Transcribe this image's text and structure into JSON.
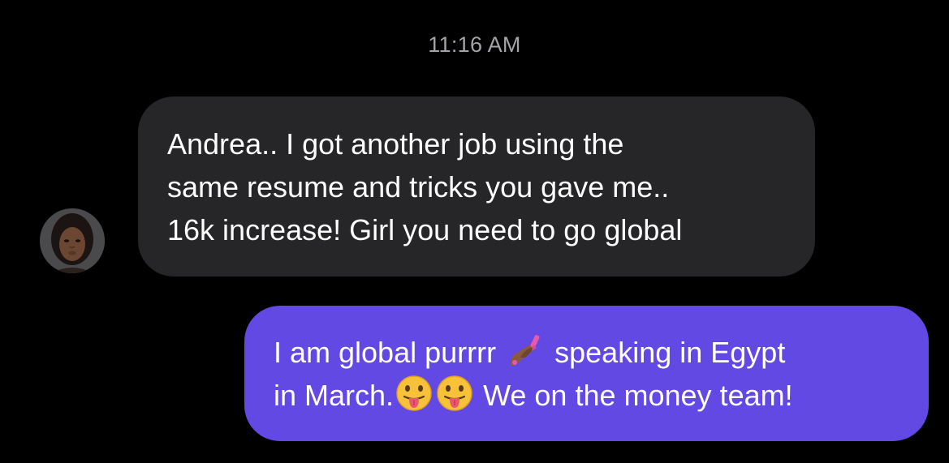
{
  "thread": {
    "timestamp": "11:16 AM"
  },
  "incoming_message": {
    "lines": [
      "Andrea.. I got another job using the",
      "same resume and tricks you gave me..",
      "16k increase! Girl you need to go global"
    ]
  },
  "outgoing_message": {
    "line1_before_emoji": "I am global purrrr",
    "line1_after_emoji": "speaking in Egypt",
    "line2_before_emoji": "in March.",
    "line2_after_emoji": "We on the money team!",
    "emojis": [
      "nail-polish-icon",
      "tongue-out-face-icon",
      "tongue-out-face-icon"
    ]
  },
  "colors": {
    "background": "#000000",
    "incoming_bubble": "#262628",
    "outgoing_bubble": "#6249e3",
    "timestamp_text": "#a3a3a8",
    "message_text": "#ffffff"
  }
}
